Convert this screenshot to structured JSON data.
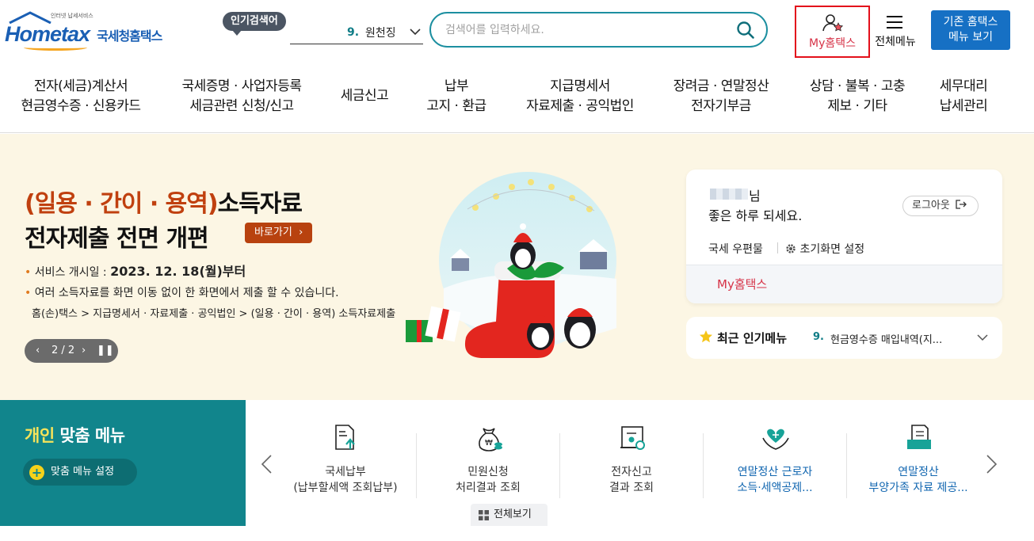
{
  "header": {
    "logo_tagline": "인터넷 납세서비스",
    "logo_brand": "Hometax",
    "logo_brand_kr": "국세청홈택스",
    "popular_badge": "인기검색어",
    "popular_rank": "9.",
    "popular_term": "원천징",
    "search_placeholder": "검색어를 입력하세요.",
    "my_hometax": "My홈택스",
    "all_menu": "전체메뉴",
    "old_menu_line1": "기존 홈택스",
    "old_menu_line2": "메뉴 보기"
  },
  "gnb": [
    {
      "line1": "전자(세금)계산서",
      "line2": "현금영수증 · 신용카드"
    },
    {
      "line1": "국세증명 · 사업자등록",
      "line2": "세금관련 신청/신고"
    },
    {
      "line1": "세금신고",
      "line2": ""
    },
    {
      "line1": "납부",
      "line2": "고지 · 환급"
    },
    {
      "line1": "지급명세서",
      "line2": "자료제출 · 공익법인"
    },
    {
      "line1": "장려금 · 연말정산",
      "line2": "전자기부금"
    },
    {
      "line1": "상담 · 불복 · 고충",
      "line2": "제보 · 기타"
    },
    {
      "line1": "세무대리",
      "line2": "납세관리"
    }
  ],
  "banner": {
    "title_highlight": "(일용 · 간이 · 용역)",
    "title_rest": "소득자료",
    "title_line2": "전자제출 전면 개편",
    "shortcut": "바로가기",
    "line1_label": "서비스 개시일 : ",
    "line1_value": "2023. 12. 18(월)부터",
    "line2": "여러 소득자료를 화면 이동 없이 한 화면에서 제출 할 수 있습니다.",
    "line3": "홈(손)택스 > 지급명세서 · 자료제출 · 공익법인 > (일용 · 간이 · 용역) 소득자료제출",
    "pager": "2 / 2"
  },
  "user": {
    "honorific": "님",
    "greeting": "좋은 하루 되세요.",
    "logout": "로그아웃",
    "mailbox": "국세 우편물",
    "init_setting": "초기화면 설정",
    "my_hometax": "My홈택스"
  },
  "recent": {
    "title": "최근 인기메뉴",
    "rank": "9.",
    "item": "현금영수증 매입내역(지..."
  },
  "custom_menu": {
    "title_highlight": "개인",
    "title_rest": " 맞춤 메뉴",
    "setting": "맞춤 메뉴 설정",
    "view_all": "전체보기",
    "items": [
      {
        "line1": "국세납부",
        "line2": "(납부할세액 조회납부)",
        "icon": "document-upload-icon"
      },
      {
        "line1": "민원신청",
        "line2": "처리결과 조회",
        "icon": "money-bag-icon"
      },
      {
        "line1": "전자신고",
        "line2": "결과 조회",
        "icon": "certificate-icon"
      },
      {
        "line1": "연말정산 근로자",
        "line2": "소득·세액공제...",
        "icon": "heart-hands-icon"
      },
      {
        "line1": "연말정산",
        "line2": "부양가족 자료 제공...",
        "icon": "folder-document-icon"
      }
    ]
  },
  "colors": {
    "brand_blue": "#1a5fb4",
    "teal": "#11858c",
    "accent_red": "#d63247",
    "banner_orange": "#c0400f"
  }
}
